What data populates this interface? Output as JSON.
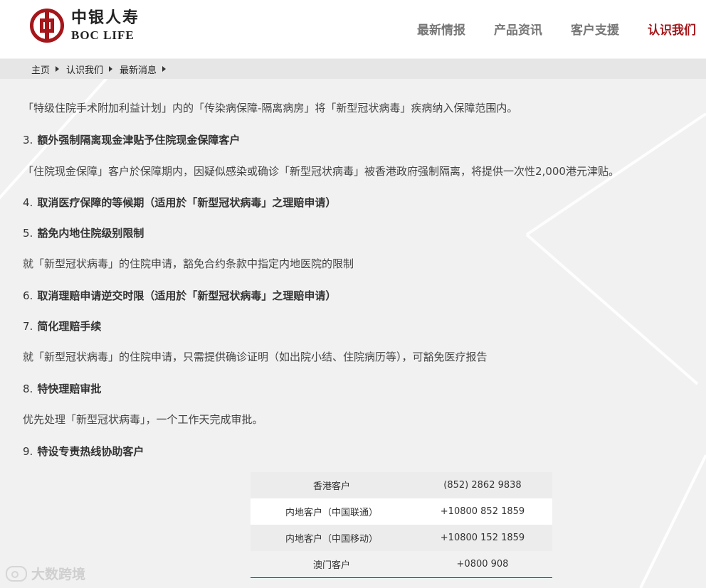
{
  "brand": {
    "name_cn": "中银人寿",
    "name_en": "BOC LIFE",
    "accent_color": "#a4161a"
  },
  "nav": {
    "items": [
      {
        "label": "最新情报"
      },
      {
        "label": "产品资讯"
      },
      {
        "label": "客户支援"
      },
      {
        "label": "认识我们",
        "active": true
      }
    ]
  },
  "breadcrumb": {
    "items": [
      {
        "label": "主页"
      },
      {
        "label": "认识我们"
      },
      {
        "label": "最新消息"
      }
    ]
  },
  "content": {
    "para_2": "「特级住院手术附加利益计划」内的「传染病保障-隔离病房」将「新型冠状病毒」疾病纳入保障范围内。",
    "item_3": {
      "num": "3.",
      "title": "额外强制隔离现金津贴予住院现金保障客户"
    },
    "para_3": "「住院现金保障」客户於保障期内，因疑似感染或确诊「新型冠状病毒」被香港政府强制隔离，将提供一次性2,000港元津贴。",
    "item_4": {
      "num": "4.",
      "title": "取消医疗保障的等候期（适用於「新型冠状病毒」之理赔申请）"
    },
    "item_5": {
      "num": "5.",
      "title": "豁免内地住院级别限制"
    },
    "para_5": "就「新型冠状病毒」的住院申请，豁免合约条款中指定内地医院的限制",
    "item_6": {
      "num": "6.",
      "title": "取消理赔申请逆交时限（适用於「新型冠状病毒」之理赔申请）"
    },
    "item_7": {
      "num": "7.",
      "title": "简化理赔手续"
    },
    "para_7": "就「新型冠状病毒」的住院申请，只需提供确诊证明（如出院小结、住院病历等），可豁免医疗报告",
    "item_8": {
      "num": "8.",
      "title": "特快理赔审批"
    },
    "para_8": "优先处理「新型冠状病毒」，一个工作天完成审批。",
    "item_9": {
      "num": "9.",
      "title": "特设专责热线协助客户"
    }
  },
  "hotline_table": {
    "rows": [
      {
        "region": "香港客户",
        "phone": "(852) 2862 9838"
      },
      {
        "region": "内地客户（中国联通）",
        "phone": "+10800 852 1859"
      },
      {
        "region": "内地客户（中国移动）",
        "phone": "+10800 152 1859"
      },
      {
        "region": "澳门客户",
        "phone": "+0800 908"
      }
    ]
  },
  "watermark": {
    "text": "大数跨境"
  }
}
